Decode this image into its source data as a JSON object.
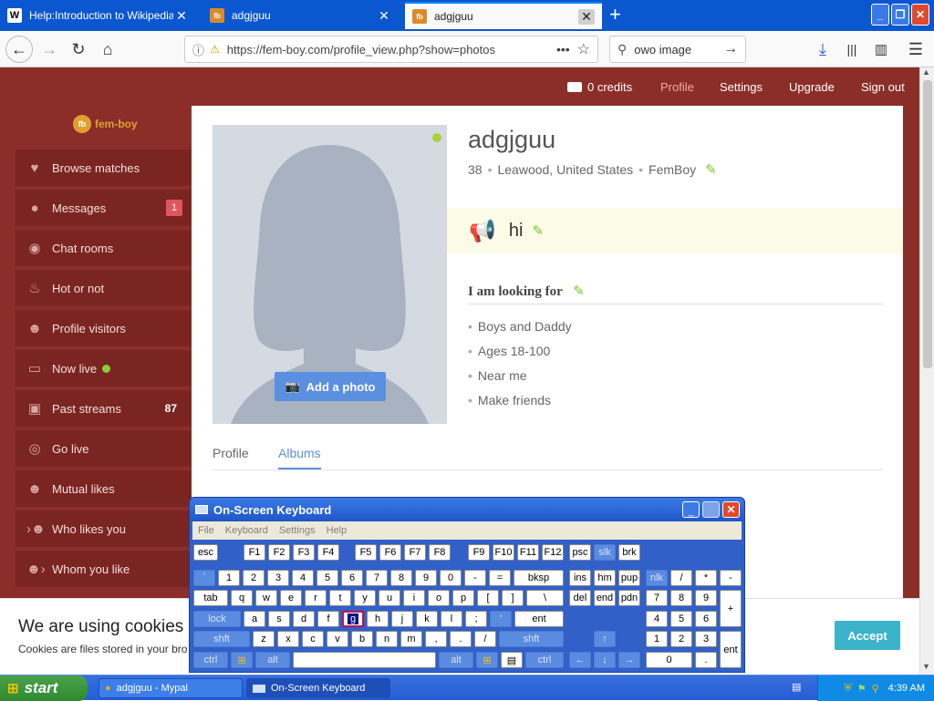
{
  "browser": {
    "tabs": [
      {
        "title": "Help:Introduction to Wikipedia - W",
        "favicon": "W"
      },
      {
        "title": "adgjguu",
        "favicon": "fb"
      },
      {
        "title": "adgjguu",
        "favicon": "fb"
      }
    ],
    "url": "https://fem-boy.com/profile_view.php?show=photos",
    "search_value": "owo image"
  },
  "site": {
    "logo_text": "fem-boy",
    "topnav": {
      "credits": "0 credits",
      "profile": "Profile",
      "settings": "Settings",
      "upgrade": "Upgrade",
      "signout": "Sign out"
    },
    "sidebar": [
      {
        "label": "Browse matches",
        "icon": "heart-icon"
      },
      {
        "label": "Messages",
        "icon": "chat-bubble-icon",
        "badge": "1"
      },
      {
        "label": "Chat rooms",
        "icon": "chat-rooms-icon"
      },
      {
        "label": "Hot or not",
        "icon": "flame-icon"
      },
      {
        "label": "Profile visitors",
        "icon": "users-icon"
      },
      {
        "label": "Now live",
        "icon": "monitor-icon"
      },
      {
        "label": "Past streams",
        "icon": "tv-icon",
        "count": "87"
      },
      {
        "label": "Go live",
        "icon": "eye-icon"
      },
      {
        "label": "Mutual likes",
        "icon": "mutual-users-icon"
      },
      {
        "label": "Who likes you",
        "icon": "user-arrow-icon"
      },
      {
        "label": "Whom you like",
        "icon": "user-arrow-icon"
      }
    ]
  },
  "profile": {
    "name": "adgjguu",
    "age": "38",
    "location": "Leawood, United States",
    "type": "FemBoy",
    "status": "hi",
    "add_photo": "Add a photo",
    "looking_for_title": "I am looking for",
    "looking_for": [
      "Boys and Daddy",
      "Ages 18-100",
      "Near me",
      "Make friends"
    ],
    "tabs": [
      "Profile",
      "Albums"
    ]
  },
  "cookie": {
    "title": "We are using cookies",
    "text": "Cookies are files stored in your bro",
    "accept": "Accept"
  },
  "osk": {
    "title": "On-Screen Keyboard",
    "menu": [
      "File",
      "Keyboard",
      "Settings",
      "Help"
    ]
  },
  "taskbar": {
    "start": "start",
    "tasks": [
      "adgjguu - Mypal",
      "On-Screen Keyboard"
    ],
    "time": "4:39 AM"
  },
  "colors": {
    "site_bg": "#8b2e2a",
    "sidebar_item": "#7a2522",
    "accent_blue": "#5b8fe0",
    "accept": "#3bb3c8",
    "edit_green": "#7cc230"
  }
}
